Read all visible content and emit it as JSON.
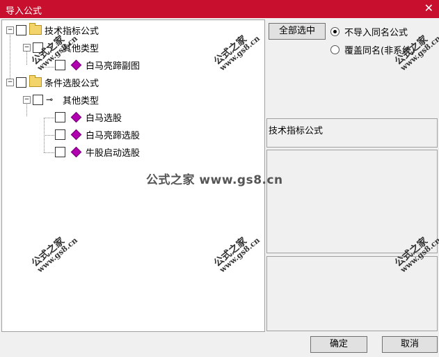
{
  "window": {
    "title": "导入公式",
    "close": "✕"
  },
  "tree": {
    "group1": {
      "label": "技术指标公式",
      "sub": {
        "label": "其他类型",
        "items": [
          "白马亮蹄副图"
        ]
      }
    },
    "group2": {
      "label": "条件选股公式",
      "sub": {
        "label": "其他类型",
        "items": [
          "白马选股",
          "白马亮蹄选股",
          "牛股启动选股"
        ]
      }
    }
  },
  "buttons": {
    "select_all": "全部选中",
    "ok": "确定",
    "cancel": "取消"
  },
  "options": {
    "opt1": "不导入同名公式",
    "opt2": "覆盖同名(非系统)",
    "selected": "opt1"
  },
  "info": {
    "type_label": "技术指标公式"
  },
  "watermark": {
    "text": "公式之家",
    "url": "www.gs8.cn",
    "center": "公式之家 www.gs8.cn"
  }
}
